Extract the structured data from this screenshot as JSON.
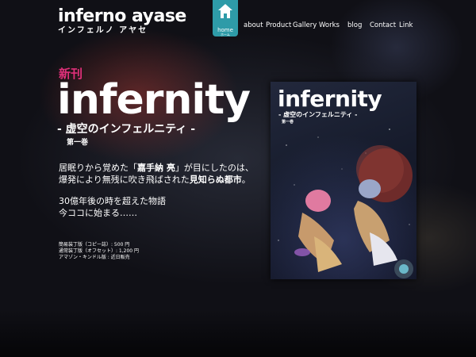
{
  "header": {
    "logo_main": "inferno ayase",
    "logo_sub": "インフェルノ アヤセ",
    "home_label": "home",
    "home_sub": "ホーム"
  },
  "nav": [
    {
      "label": "about"
    },
    {
      "label": "Product"
    },
    {
      "label": "Gallery"
    },
    {
      "label": "Works"
    },
    {
      "label": "blog"
    },
    {
      "label": "Contact"
    },
    {
      "label": "Link"
    }
  ],
  "hero": {
    "new_label": "新刊",
    "title": "infernity",
    "subtitle": "- 虚空のインフェルニティ -",
    "volume": "第一巻",
    "desc_line1_a": "居眠りから覚めた「",
    "desc_line1_b": "嘉手納 亮",
    "desc_line1_c": "」が目にしたのは、",
    "desc_line2_a": "爆発により無残に吹き飛ばされた",
    "desc_line2_b": "見知らぬ都市",
    "desc_line2_c": "。",
    "tagline_line1": "30億年後の時を超えた物語",
    "tagline_line2": "今ココに始まる……",
    "editions": [
      "簡易装丁版（コピー誌）: 500 円",
      "通常装丁版（オフセット）: 1,200 円",
      "アマゾン・キンドル版 : 近日販売"
    ]
  },
  "cover": {
    "title": "infernity",
    "subtitle": "- 虚空のインフェルニティ -",
    "volume": "第一巻"
  },
  "colors": {
    "accent_pink": "#e0307a",
    "home_teal": "#2e9ba8"
  }
}
